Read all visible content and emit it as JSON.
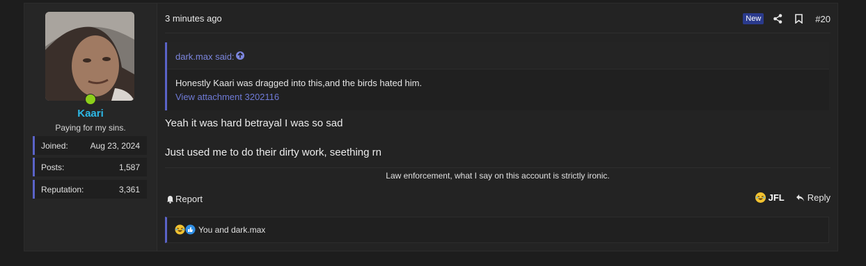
{
  "post": {
    "user": {
      "name": "Kaari",
      "title": "Paying for my sins.",
      "stats": [
        {
          "label": "Joined:",
          "value": "Aug 23, 2024"
        },
        {
          "label": "Posts:",
          "value": "1,587"
        },
        {
          "label": "Reputation:",
          "value": "3,361"
        }
      ],
      "online_color": "#8ccf1a",
      "name_color": "#2db8e6"
    },
    "header": {
      "date": "3 minutes ago",
      "new_badge": "New",
      "post_number": "#20",
      "share_icon": "share-icon",
      "bookmark_icon": "bookmark-icon"
    },
    "quote": {
      "author": "dark.max said:",
      "text": "Honestly Kaari was dragged into this,and the birds hated him.",
      "attachment_link": "View attachment 3202116"
    },
    "message_lines": [
      "Yeah it was hard betrayal I was so sad",
      "Just used me to do their dirty work, seething rn"
    ],
    "signature": "Law enforcement, what I say on this account is strictly ironic.",
    "footer": {
      "report_label": "Report",
      "jfl_label": "JFL",
      "reply_label": "Reply"
    },
    "reactions": {
      "text": "You and dark.max"
    },
    "accent_color": "#5a63c8"
  }
}
